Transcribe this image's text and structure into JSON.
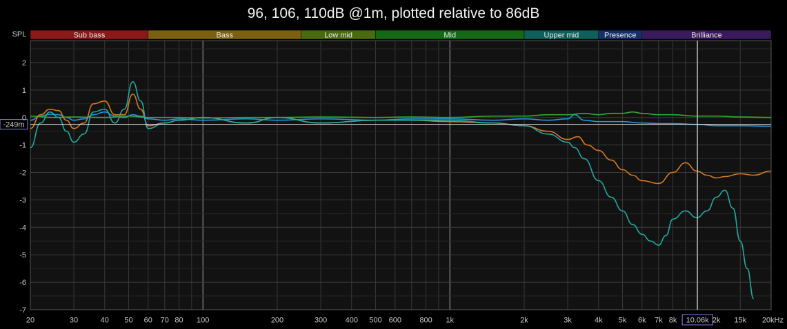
{
  "title": "96, 106, 110dB @1m, plotted relative to 86dB",
  "chart_data": {
    "type": "line",
    "title": "96, 106, 110dB @1m, plotted relative to 86dB",
    "ylabel": "SPL",
    "xlabel": "",
    "x_scale": "log",
    "xlim": [
      20,
      20000
    ],
    "ylim": [
      -7,
      2.8
    ],
    "grid": true,
    "x_tick_labels": [
      {
        "v": 20,
        "t": "20"
      },
      {
        "v": 30,
        "t": "30"
      },
      {
        "v": 40,
        "t": "40"
      },
      {
        "v": 50,
        "t": "50"
      },
      {
        "v": 60,
        "t": "60"
      },
      {
        "v": 70,
        "t": "70"
      },
      {
        "v": 80,
        "t": "80"
      },
      {
        "v": 100,
        "t": "100"
      },
      {
        "v": 200,
        "t": "200"
      },
      {
        "v": 300,
        "t": "300"
      },
      {
        "v": 400,
        "t": "400"
      },
      {
        "v": 500,
        "t": "500"
      },
      {
        "v": 600,
        "t": "600"
      },
      {
        "v": 800,
        "t": "800"
      },
      {
        "v": 1000,
        "t": "1k"
      },
      {
        "v": 2000,
        "t": "2k"
      },
      {
        "v": 3000,
        "t": "3k"
      },
      {
        "v": 4000,
        "t": "4k"
      },
      {
        "v": 5000,
        "t": "5k"
      },
      {
        "v": 6000,
        "t": "6k"
      },
      {
        "v": 7000,
        "t": "7k"
      },
      {
        "v": 8000,
        "t": "8k"
      },
      {
        "v": 12000,
        "t": "2k"
      },
      {
        "v": 15000,
        "t": "15k"
      },
      {
        "v": 20000,
        "t": "20kHz"
      }
    ],
    "y_ticks": [
      2,
      1,
      0,
      -1,
      -2,
      -3,
      -4,
      -5,
      -6,
      -7
    ],
    "bands": [
      {
        "name": "Sub bass",
        "from": 20,
        "to": 60,
        "color": "#8a1a1a"
      },
      {
        "name": "Bass",
        "from": 60,
        "to": 250,
        "color": "#7a6010"
      },
      {
        "name": "Low mid",
        "from": 250,
        "to": 500,
        "color": "#4a6a10"
      },
      {
        "name": "Mid",
        "from": 500,
        "to": 2000,
        "color": "#146a14"
      },
      {
        "name": "Upper mid",
        "from": 2000,
        "to": 4000,
        "color": "#0f5f5a"
      },
      {
        "name": "Presence",
        "from": 4000,
        "to": 6000,
        "color": "#16306a"
      },
      {
        "name": "Brilliance",
        "from": 6000,
        "to": 20000,
        "color": "#3a1a5e"
      }
    ],
    "cursor": {
      "x": 10060,
      "x_label": "10.06k",
      "y": -0.249,
      "y_label": "-249m"
    },
    "series": [
      {
        "color": "#1e96e6",
        "x": [
          20,
          22,
          24,
          26,
          28,
          30,
          33,
          36,
          40,
          44,
          48,
          52,
          56,
          60,
          70,
          80,
          100,
          150,
          200,
          300,
          500,
          700,
          1000,
          1500,
          2000,
          2500,
          3000,
          3200,
          3500,
          4000,
          5000,
          6000,
          7000,
          8000,
          10000,
          12000,
          15000,
          20000
        ],
        "y": [
          -0.1,
          0.05,
          0.12,
          0.1,
          0.0,
          -0.1,
          -0.05,
          0.1,
          0.2,
          0.05,
          0.0,
          0.1,
          0.05,
          -0.05,
          -0.1,
          -0.05,
          -0.1,
          -0.05,
          -0.1,
          -0.05,
          -0.1,
          -0.05,
          -0.05,
          -0.1,
          -0.05,
          -0.1,
          -0.05,
          0.1,
          -0.1,
          -0.15,
          -0.15,
          -0.2,
          -0.22,
          -0.22,
          -0.25,
          -0.3,
          -0.3,
          -0.32
        ]
      },
      {
        "color": "#34a834",
        "x": [
          20,
          25,
          30,
          40,
          50,
          60,
          80,
          100,
          150,
          200,
          300,
          500,
          700,
          1000,
          1500,
          2000,
          2500,
          3000,
          3500,
          4000,
          4500,
          5000,
          5500,
          6000,
          7000,
          8000,
          10000,
          12000,
          15000,
          20000
        ],
        "y": [
          0.05,
          0.0,
          0.02,
          0.0,
          0.05,
          0.0,
          0.0,
          -0.02,
          0.0,
          0.0,
          0.02,
          0.0,
          0.02,
          0.0,
          0.05,
          0.05,
          0.1,
          0.1,
          0.15,
          0.1,
          0.15,
          0.15,
          0.2,
          0.15,
          0.1,
          0.1,
          0.05,
          0.05,
          0.02,
          0.0
        ]
      },
      {
        "color": "#d97a1e",
        "x": [
          20,
          22,
          24,
          26,
          28,
          30,
          33,
          36,
          40,
          44,
          48,
          52,
          56,
          60,
          70,
          80,
          100,
          150,
          200,
          300,
          500,
          700,
          1000,
          1500,
          2000,
          2500,
          3000,
          3300,
          3600,
          4000,
          4500,
          5000,
          5500,
          6000,
          7000,
          8000,
          9000,
          10000,
          11000,
          12000,
          13000,
          15000,
          17000,
          20000
        ],
        "y": [
          -0.4,
          0.1,
          0.3,
          0.25,
          -0.1,
          -0.4,
          -0.2,
          0.5,
          0.6,
          0.1,
          0.1,
          0.85,
          0.3,
          -0.3,
          -0.2,
          -0.1,
          0.0,
          -0.2,
          0.0,
          -0.2,
          -0.1,
          -0.1,
          -0.15,
          -0.2,
          -0.3,
          -0.5,
          -0.8,
          -0.7,
          -1.0,
          -1.2,
          -1.55,
          -1.9,
          -2.1,
          -2.3,
          -2.4,
          -2.0,
          -1.65,
          -1.95,
          -2.1,
          -2.2,
          -2.15,
          -2.05,
          -2.1,
          -1.95
        ]
      },
      {
        "color": "#22aaa0",
        "x": [
          20,
          22,
          24,
          26,
          28,
          30,
          33,
          36,
          40,
          44,
          48,
          52,
          56,
          60,
          70,
          80,
          100,
          150,
          200,
          300,
          500,
          700,
          1000,
          1500,
          2000,
          2500,
          3000,
          3200,
          3500,
          4000,
          4500,
          5000,
          5500,
          6000,
          6500,
          7000,
          7500,
          8000,
          9000,
          10000,
          11000,
          12000,
          13000,
          14000,
          15000,
          16000,
          17000,
          18000
        ],
        "y": [
          -1.1,
          -0.2,
          0.2,
          0.0,
          -0.5,
          -0.9,
          -0.6,
          0.2,
          0.3,
          -0.2,
          0.3,
          1.3,
          0.6,
          -0.4,
          -0.2,
          -0.1,
          0.0,
          -0.2,
          0.0,
          -0.2,
          -0.1,
          -0.1,
          -0.1,
          -0.2,
          -0.3,
          -0.6,
          -0.9,
          -1.1,
          -1.5,
          -2.3,
          -2.9,
          -3.4,
          -3.9,
          -4.25,
          -4.5,
          -4.65,
          -4.3,
          -3.7,
          -3.4,
          -3.65,
          -3.4,
          -2.9,
          -2.65,
          -3.3,
          -4.5,
          -5.5,
          -6.6,
          -7.5
        ]
      }
    ]
  }
}
